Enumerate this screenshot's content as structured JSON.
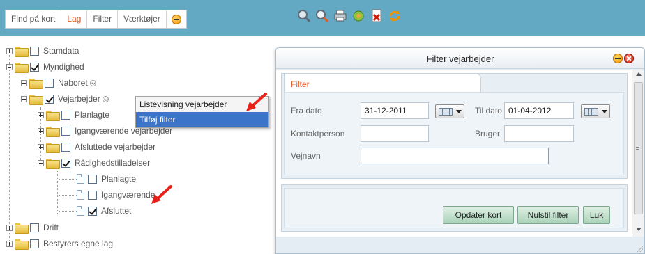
{
  "tabs": [
    "Find på kort",
    "Lag",
    "Filter",
    "Værktøjer"
  ],
  "active_tab": "Lag",
  "toolbar_icons": [
    "zoom-region-icon",
    "zoom-search-icon",
    "print-icon",
    "layers-settings-icon",
    "delete-document-icon",
    "refresh-icon"
  ],
  "tree": {
    "items": [
      {
        "label": "Stamdata",
        "checked": false
      },
      {
        "label": "Myndighed",
        "checked": true
      },
      {
        "label": "Naboret",
        "checked": false
      },
      {
        "label": "Vejarbejder",
        "checked": true
      },
      {
        "label": "Planlagte",
        "checked": false
      },
      {
        "label": "Igangværende vejarbejder",
        "checked": false
      },
      {
        "label": "Afsluttede vejarbejder",
        "checked": false
      },
      {
        "label": "Rådighedstilladelser",
        "checked": true
      },
      {
        "label": "Planlagte",
        "checked": false
      },
      {
        "label": "Igangværende",
        "checked": false
      },
      {
        "label": "Afsluttet",
        "checked": true
      },
      {
        "label": "Drift",
        "checked": false
      },
      {
        "label": "Bestyrers egne lag",
        "checked": false
      }
    ]
  },
  "context_menu": {
    "items": [
      "Listevisning vejarbejder",
      "Tilføj filter"
    ],
    "selected": "Tilføj filter"
  },
  "dialog": {
    "title": "Filter vejarbejder",
    "tab_label": "Filter",
    "fields": {
      "fra_dato": {
        "label": "Fra dato",
        "value": "31-12-2011"
      },
      "til_dato": {
        "label": "Til dato",
        "value": "01-04-2012"
      },
      "kontaktperson": {
        "label": "Kontaktperson",
        "value": ""
      },
      "bruger": {
        "label": "Bruger",
        "value": ""
      },
      "vejnavn": {
        "label": "Vejnavn",
        "value": ""
      }
    },
    "buttons": {
      "opdater": "Opdater kort",
      "nulstil": "Nulstil filter",
      "luk": "Luk"
    }
  },
  "colors": {
    "topbar": "#64a9c3",
    "accent": "#e35d2b",
    "menu_highlight": "#3b74c8",
    "annotation_arrow": "#e8221b"
  }
}
